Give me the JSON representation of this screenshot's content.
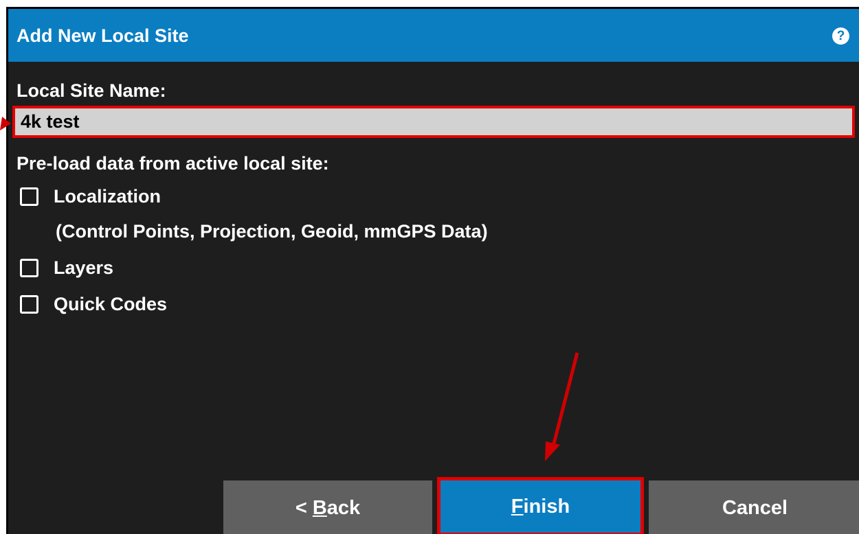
{
  "dialog": {
    "title": "Add New Local Site",
    "help_icon": "?"
  },
  "site_name": {
    "label": "Local Site Name:",
    "value": "4k test"
  },
  "preload": {
    "label": "Pre-load data from active local site:",
    "options": [
      {
        "label": "Localization",
        "checked": false
      },
      {
        "label": "Layers",
        "checked": false
      },
      {
        "label": "Quick Codes",
        "checked": false
      }
    ],
    "localization_detail": "(Control Points, Projection, Geoid, mmGPS Data)"
  },
  "buttons": {
    "back_prefix": "< ",
    "back_mnemonic": "B",
    "back_rest": "ack",
    "finish_mnemonic": "F",
    "finish_rest": "inish",
    "cancel": "Cancel"
  },
  "colors": {
    "accent": "#0b7ec2",
    "highlight": "#e20000",
    "background": "#1e1e1e"
  }
}
